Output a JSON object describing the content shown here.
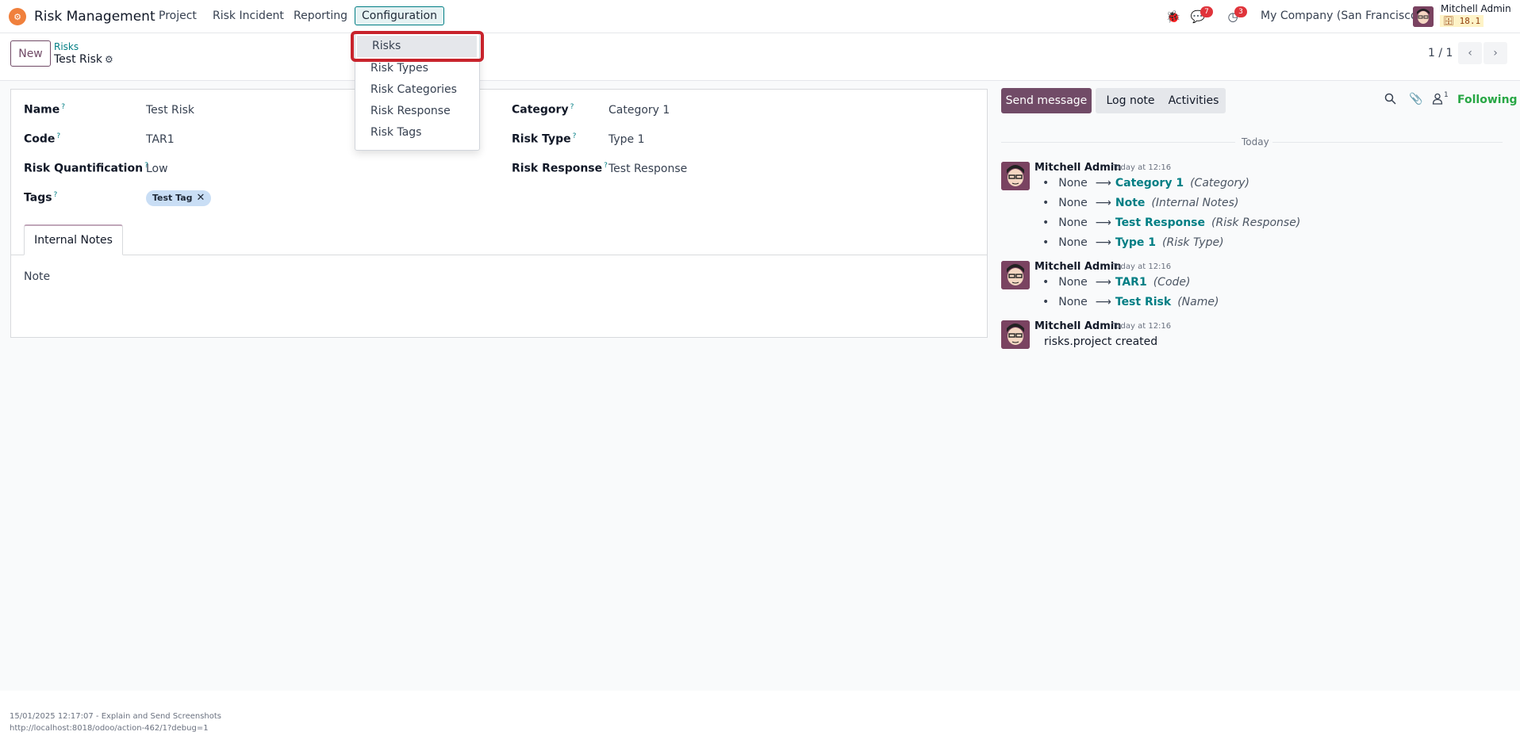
{
  "navbar": {
    "app_title": "Risk Management",
    "menu": [
      "Project",
      "Risk Incident",
      "Reporting",
      "Configuration"
    ],
    "messages_count": "7",
    "activities_count": "3",
    "company": "My Company (San Francisco)",
    "user_name": "Mitchell Admin",
    "db_version": "18.1"
  },
  "control_panel": {
    "new_label": "New",
    "breadcrumb_parent": "Risks",
    "breadcrumb_current": "Test Risk",
    "pager": "1 / 1"
  },
  "config_menu": {
    "items": [
      "Risks",
      "Risk Types",
      "Risk Categories",
      "Risk Response",
      "Risk Tags"
    ]
  },
  "form": {
    "name_label": "Name",
    "name_value": "Test Risk",
    "code_label": "Code",
    "code_value": "TAR1",
    "quant_label": "Risk Quantification",
    "quant_value": "Low",
    "tags_label": "Tags",
    "tag": "Test Tag",
    "category_label": "Category",
    "category_value": "Category 1",
    "risk_type_label": "Risk Type",
    "risk_type_value": "Type 1",
    "risk_response_label": "Risk Response",
    "risk_response_value": "Test Response",
    "tab_label": "Internal Notes",
    "notes_value": "Note"
  },
  "chatter": {
    "send_message": "Send message",
    "log_note": "Log note",
    "activities": "Activities",
    "followers_count": "1",
    "following": "Following",
    "date_separator": "Today",
    "messages": [
      {
        "author": "Mitchell Admin",
        "time": "Today at 12:16",
        "tracking": [
          {
            "old": "None",
            "new": "Category 1",
            "field": "(Category)"
          },
          {
            "old": "None",
            "new": "Note",
            "field": "(Internal Notes)"
          },
          {
            "old": "None",
            "new": "Test Response",
            "field": "(Risk Response)"
          },
          {
            "old": "None",
            "new": "Type 1",
            "field": "(Risk Type)"
          }
        ]
      },
      {
        "author": "Mitchell Admin",
        "time": "Today at 12:16",
        "tracking": [
          {
            "old": "None",
            "new": "TAR1",
            "field": "(Code)"
          },
          {
            "old": "None",
            "new": "Test Risk",
            "field": "(Name)"
          }
        ]
      },
      {
        "author": "Mitchell Admin",
        "time": "Today at 12:16",
        "body": "risks.project created"
      }
    ]
  },
  "footer": {
    "line1": "15/01/2025 12:17:07 - Explain and Send Screenshots",
    "line2": "http://localhost:8018/odoo/action-462/1?debug=1"
  },
  "colors": {
    "brand": "#714b67",
    "link": "#017e84",
    "highlight": "#c8232c",
    "following": "#28a745"
  }
}
